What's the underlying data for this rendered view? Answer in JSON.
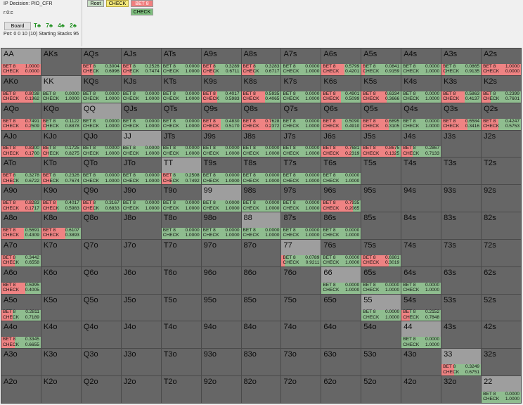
{
  "info": {
    "decision": "IP Decision:  PIO_CFR",
    "path": "r:0:c",
    "board_button": "Board",
    "board_cards": [
      "T♣",
      "7♣",
      "4♣",
      "2♣"
    ],
    "pot_line": "Pot: 0 0 10 (10) Starting Stacks 95"
  },
  "tree": {
    "root": "Root",
    "check": "CHECK",
    "bet": "BET 8",
    "check_child": "CHECK"
  },
  "colors": {
    "bet": "#ef8383",
    "check": "#8fbd8f",
    "empty": "#666666",
    "selected_tree_node": "#f5e97a"
  },
  "labels": {
    "bet": "BET 8",
    "check": "CHECK"
  },
  "grid": [
    [
      {
        "hand": "AA",
        "bet": "1.0000",
        "check": "0.0000",
        "sel": true
      },
      {
        "hand": "AKs"
      },
      {
        "hand": "AQs",
        "bet": "0.3004",
        "check": "0.6996"
      },
      {
        "hand": "AJs",
        "bet": "0.2526",
        "check": "0.7474"
      },
      {
        "hand": "ATs",
        "bet": "0.0000",
        "check": "1.0000"
      },
      {
        "hand": "A9s",
        "bet": "0.3289",
        "check": "0.6711"
      },
      {
        "hand": "A8s",
        "bet": "0.3283",
        "check": "0.6717"
      },
      {
        "hand": "A7s",
        "bet": "0.0000",
        "check": "1.0000"
      },
      {
        "hand": "A6s",
        "bet": "0.5799",
        "check": "0.4201"
      },
      {
        "hand": "A5s",
        "bet": "0.0841",
        "check": "0.9159"
      },
      {
        "hand": "A4s",
        "bet": "0.0000",
        "check": "1.0000"
      },
      {
        "hand": "A3s",
        "bet": "0.0865",
        "check": "0.9135"
      },
      {
        "hand": "A2s",
        "bet": "1.0000",
        "check": "0.0000"
      }
    ],
    [
      {
        "hand": "AKo",
        "bet": "0.8038",
        "check": "0.1962"
      },
      {
        "hand": "KK",
        "bet": "0.0000",
        "check": "1.0000",
        "sel": true
      },
      {
        "hand": "KQs",
        "bet": "0.0000",
        "check": "1.0000"
      },
      {
        "hand": "KJs",
        "bet": "0.0000",
        "check": "1.0000"
      },
      {
        "hand": "KTs",
        "bet": "0.0000",
        "check": "1.0000"
      },
      {
        "hand": "K9s",
        "bet": "0.4017",
        "check": "0.5983"
      },
      {
        "hand": "K8s",
        "bet": "0.5935",
        "check": "0.4065"
      },
      {
        "hand": "K7s",
        "bet": "0.0000",
        "check": "1.0000"
      },
      {
        "hand": "K6s",
        "bet": "0.4901",
        "check": "0.5099"
      },
      {
        "hand": "K5s",
        "bet": "0.6334",
        "check": "0.3666"
      },
      {
        "hand": "K4s",
        "bet": "0.0000",
        "check": "1.0000"
      },
      {
        "hand": "K3s",
        "bet": "0.5863",
        "check": "0.4137"
      },
      {
        "hand": "K2s",
        "bet": "0.2399",
        "check": "0.7601"
      }
    ],
    [
      {
        "hand": "AQo",
        "bet": "0.7491",
        "check": "0.2509"
      },
      {
        "hand": "KQo",
        "bet": "0.1122",
        "check": "0.8878"
      },
      {
        "hand": "QQ",
        "bet": "0.0000",
        "check": "1.0000",
        "sel": true
      },
      {
        "hand": "QJs",
        "bet": "0.0000",
        "check": "1.0000"
      },
      {
        "hand": "QTs",
        "bet": "0.0000",
        "check": "1.0000"
      },
      {
        "hand": "Q9s",
        "bet": "0.4830",
        "check": "0.5170"
      },
      {
        "hand": "Q8s",
        "bet": "0.7628",
        "check": "0.2372"
      },
      {
        "hand": "Q7s",
        "bet": "0.0000",
        "check": "1.0000"
      },
      {
        "hand": "Q6s",
        "bet": "0.5090",
        "check": "0.4910"
      },
      {
        "hand": "Q5s",
        "bet": "0.6895",
        "check": "0.3105"
      },
      {
        "hand": "Q4s",
        "bet": "0.0000",
        "check": "1.0000"
      },
      {
        "hand": "Q3s",
        "bet": "0.6584",
        "check": "0.3416"
      },
      {
        "hand": "Q2s",
        "bet": "0.4247",
        "check": "0.5753"
      }
    ],
    [
      {
        "hand": "AJo",
        "bet": "0.8300",
        "check": "0.1700"
      },
      {
        "hand": "KJo",
        "bet": "0.1725",
        "check": "0.8275"
      },
      {
        "hand": "QJo",
        "bet": "0.0000",
        "check": "1.0000"
      },
      {
        "hand": "JJ",
        "bet": "0.0000",
        "check": "1.0000",
        "sel": true
      },
      {
        "hand": "JTs",
        "bet": "0.0000",
        "check": "1.0000"
      },
      {
        "hand": "J9s",
        "bet": "0.0000",
        "check": "1.0000"
      },
      {
        "hand": "J8s",
        "bet": "0.0000",
        "check": "1.0000"
      },
      {
        "hand": "J7s",
        "bet": "0.0000",
        "check": "1.0000"
      },
      {
        "hand": "J6s",
        "bet": "0.7681",
        "check": "0.2319"
      },
      {
        "hand": "J5s",
        "bet": "0.8675",
        "check": "0.1325"
      },
      {
        "hand": "J4s",
        "bet": "0.2867",
        "check": "0.7133"
      },
      {
        "hand": "J3s"
      },
      {
        "hand": "J2s"
      }
    ],
    [
      {
        "hand": "ATo",
        "bet": "0.3278",
        "check": "0.6722"
      },
      {
        "hand": "KTo",
        "bet": "0.2326",
        "check": "0.7674"
      },
      {
        "hand": "QTo",
        "bet": "0.0000",
        "check": "1.0000"
      },
      {
        "hand": "JTo",
        "bet": "0.0000",
        "check": "1.0000"
      },
      {
        "hand": "TT",
        "bet": "0.2508",
        "check": "0.7492",
        "sel": true
      },
      {
        "hand": "T9s",
        "bet": "0.0000",
        "check": "1.0000"
      },
      {
        "hand": "T8s",
        "bet": "0.0000",
        "check": "1.0000"
      },
      {
        "hand": "T7s",
        "bet": "0.0000",
        "check": "1.0000"
      },
      {
        "hand": "T6s",
        "bet": "0.0000",
        "check": "1.0000"
      },
      {
        "hand": "T5s"
      },
      {
        "hand": "T4s"
      },
      {
        "hand": "T3s"
      },
      {
        "hand": "T2s"
      }
    ],
    [
      {
        "hand": "A9o",
        "bet": "0.8283",
        "check": "0.1717"
      },
      {
        "hand": "K9o",
        "bet": "0.4017",
        "check": "0.5983"
      },
      {
        "hand": "Q9o",
        "bet": "0.3167",
        "check": "0.6833"
      },
      {
        "hand": "J9o",
        "bet": "0.0000",
        "check": "1.0000"
      },
      {
        "hand": "T9o",
        "bet": "0.0000",
        "check": "1.0000"
      },
      {
        "hand": "99",
        "bet": "0.0000",
        "check": "1.0000",
        "sel": true
      },
      {
        "hand": "98s",
        "bet": "0.0000",
        "check": "1.0000"
      },
      {
        "hand": "97s",
        "bet": "0.0000",
        "check": "1.0000"
      },
      {
        "hand": "96s",
        "bet": "0.7935",
        "check": "0.2065"
      },
      {
        "hand": "95s"
      },
      {
        "hand": "94s"
      },
      {
        "hand": "93s"
      },
      {
        "hand": "92s"
      }
    ],
    [
      {
        "hand": "A8o",
        "bet": "0.5691",
        "check": "0.4309"
      },
      {
        "hand": "K8o",
        "bet": "0.6107",
        "check": "0.3893"
      },
      {
        "hand": "Q8o"
      },
      {
        "hand": "J8o"
      },
      {
        "hand": "T8o",
        "bet": "0.0000",
        "check": "1.0000"
      },
      {
        "hand": "98o",
        "bet": "0.0000",
        "check": "1.0000"
      },
      {
        "hand": "88",
        "bet": "0.0000",
        "check": "1.0000",
        "sel": true
      },
      {
        "hand": "87s",
        "bet": "0.0000",
        "check": "1.0000"
      },
      {
        "hand": "86s",
        "bet": "0.0000",
        "check": "1.0000"
      },
      {
        "hand": "85s"
      },
      {
        "hand": "84s"
      },
      {
        "hand": "83s"
      },
      {
        "hand": "82s"
      }
    ],
    [
      {
        "hand": "A7o",
        "bet": "0.3442",
        "check": "0.6558"
      },
      {
        "hand": "K7o"
      },
      {
        "hand": "Q7o"
      },
      {
        "hand": "J7o"
      },
      {
        "hand": "T7o"
      },
      {
        "hand": "97o"
      },
      {
        "hand": "87o"
      },
      {
        "hand": "77",
        "bet": "0.0789",
        "check": "0.9211",
        "sel": true
      },
      {
        "hand": "76s",
        "bet": "0.0000",
        "check": "1.0000"
      },
      {
        "hand": "75s",
        "bet": "0.6981",
        "check": "0.3019"
      },
      {
        "hand": "74s"
      },
      {
        "hand": "73s"
      },
      {
        "hand": "72s"
      }
    ],
    [
      {
        "hand": "A6o",
        "bet": "0.5995",
        "check": "0.4005"
      },
      {
        "hand": "K6o"
      },
      {
        "hand": "Q6o"
      },
      {
        "hand": "J6o"
      },
      {
        "hand": "T6o"
      },
      {
        "hand": "96o"
      },
      {
        "hand": "86o"
      },
      {
        "hand": "76o"
      },
      {
        "hand": "66",
        "bet": "0.0000",
        "check": "1.0000",
        "sel": true
      },
      {
        "hand": "65s",
        "bet": "0.0000",
        "check": "1.0000"
      },
      {
        "hand": "64s",
        "bet": "0.0000",
        "check": "1.0000"
      },
      {
        "hand": "63s"
      },
      {
        "hand": "62s"
      }
    ],
    [
      {
        "hand": "A5o",
        "bet": "0.2811",
        "check": "0.7189"
      },
      {
        "hand": "K5o"
      },
      {
        "hand": "Q5o"
      },
      {
        "hand": "J5o"
      },
      {
        "hand": "T5o"
      },
      {
        "hand": "95o"
      },
      {
        "hand": "85o"
      },
      {
        "hand": "75o"
      },
      {
        "hand": "65o"
      },
      {
        "hand": "55",
        "bet": "0.0000",
        "check": "1.0000",
        "sel": true
      },
      {
        "hand": "54s",
        "bet": "0.2152",
        "check": "0.7848"
      },
      {
        "hand": "53s"
      },
      {
        "hand": "52s"
      }
    ],
    [
      {
        "hand": "A4o",
        "bet": "0.3345",
        "check": "0.6655"
      },
      {
        "hand": "K4o"
      },
      {
        "hand": "Q4o"
      },
      {
        "hand": "J4o"
      },
      {
        "hand": "T4o"
      },
      {
        "hand": "94o"
      },
      {
        "hand": "84o"
      },
      {
        "hand": "74o"
      },
      {
        "hand": "64o"
      },
      {
        "hand": "54o"
      },
      {
        "hand": "44",
        "bet": "0.0000",
        "check": "1.0000",
        "sel": true
      },
      {
        "hand": "43s"
      },
      {
        "hand": "42s"
      }
    ],
    [
      {
        "hand": "A3o"
      },
      {
        "hand": "K3o"
      },
      {
        "hand": "Q3o"
      },
      {
        "hand": "J3o"
      },
      {
        "hand": "T3o"
      },
      {
        "hand": "93o"
      },
      {
        "hand": "83o"
      },
      {
        "hand": "73o"
      },
      {
        "hand": "63o"
      },
      {
        "hand": "53o"
      },
      {
        "hand": "43o"
      },
      {
        "hand": "33",
        "bet": "0.3249",
        "check": "0.6751",
        "sel": true
      },
      {
        "hand": "32s"
      }
    ],
    [
      {
        "hand": "A2o"
      },
      {
        "hand": "K2o"
      },
      {
        "hand": "Q2o"
      },
      {
        "hand": "J2o"
      },
      {
        "hand": "T2o"
      },
      {
        "hand": "92o"
      },
      {
        "hand": "82o"
      },
      {
        "hand": "72o"
      },
      {
        "hand": "62o"
      },
      {
        "hand": "52o"
      },
      {
        "hand": "42o"
      },
      {
        "hand": "32o"
      },
      {
        "hand": "22",
        "bet": "0.0000",
        "check": "1.0000",
        "sel": true
      }
    ]
  ]
}
